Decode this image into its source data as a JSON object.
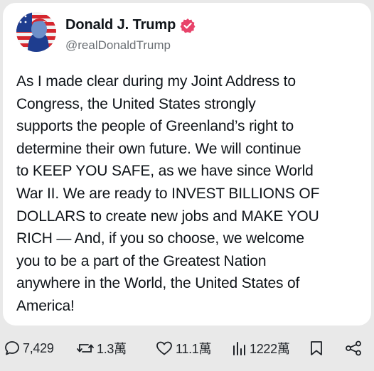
{
  "post": {
    "author_name": "Donald J. Trump",
    "author_handle": "@realDonaldTrump",
    "lines": [
      "As I made clear during my Joint Address to",
      "Congress, the United States strongly",
      "supports the people of Greenland’s right to",
      "determine their own future. We will continue",
      "to KEEP YOU SAFE, as we have since World",
      "War II. We are ready to INVEST BILLIONS OF",
      "DOLLARS to create new jobs and MAKE YOU",
      "RICH — And, if you so choose, we welcome",
      "you to be a part of the Greatest Nation",
      "anywhere in the World, the United States of",
      "America!"
    ]
  },
  "stats": {
    "replies": "7,429",
    "reposts": "1.3萬",
    "likes": "11.1萬",
    "views": "1222萬"
  },
  "icons": {
    "verified_badge": "verified-badge-icon",
    "reply": "comment-icon",
    "repost": "repost-icon",
    "like": "heart-icon",
    "views": "bar-chart-icon",
    "bookmark": "bookmark-icon",
    "share": "share-icon"
  },
  "colors": {
    "badge": "#e8436a",
    "text": "#0f1419",
    "muted": "#6b7075"
  }
}
